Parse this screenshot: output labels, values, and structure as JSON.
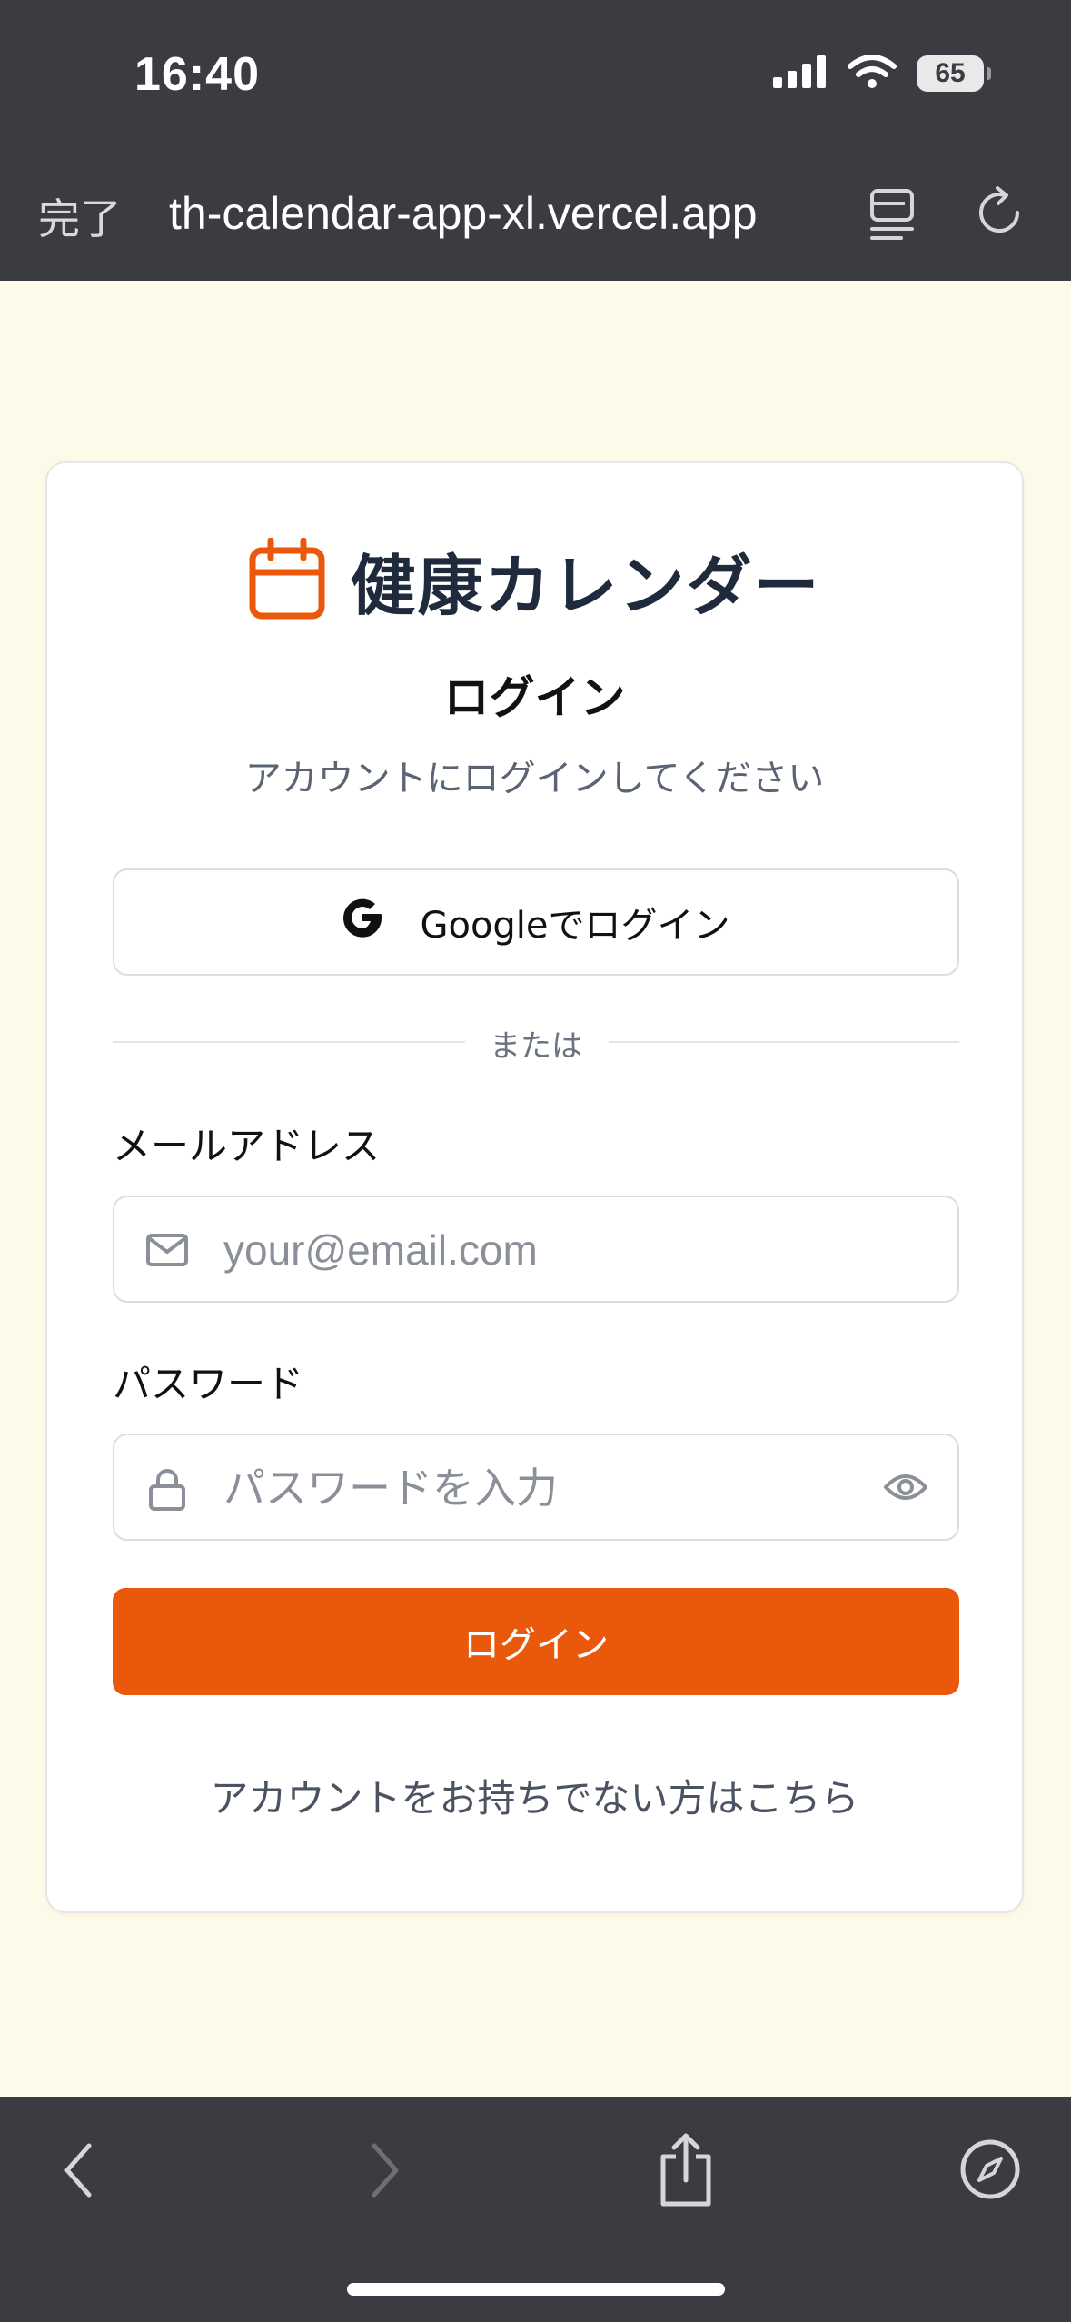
{
  "status_bar": {
    "time": "16:40",
    "battery": "65"
  },
  "browser": {
    "done_label": "完了",
    "url": "th-calendar-app-xl.vercel.app"
  },
  "app": {
    "title": "健康カレンダー",
    "accent_color": "#ea580c"
  },
  "login": {
    "heading": "ログイン",
    "subtitle": "アカウントにログインしてください",
    "google_button": "Googleでログイン",
    "divider": "または",
    "email_label": "メールアドレス",
    "email_placeholder": "your@email.com",
    "password_label": "パスワード",
    "password_placeholder": "パスワードを入力",
    "submit_button": "ログイン",
    "signup_link": "アカウントをお持ちでない方はこちら"
  },
  "icons": {
    "brand": "calendar-icon",
    "google": "google-icon",
    "email": "mail-icon",
    "password": "lock-icon",
    "toggle_password": "eye-icon",
    "nav": [
      "back-icon",
      "forward-icon",
      "share-icon",
      "compass-icon"
    ]
  }
}
